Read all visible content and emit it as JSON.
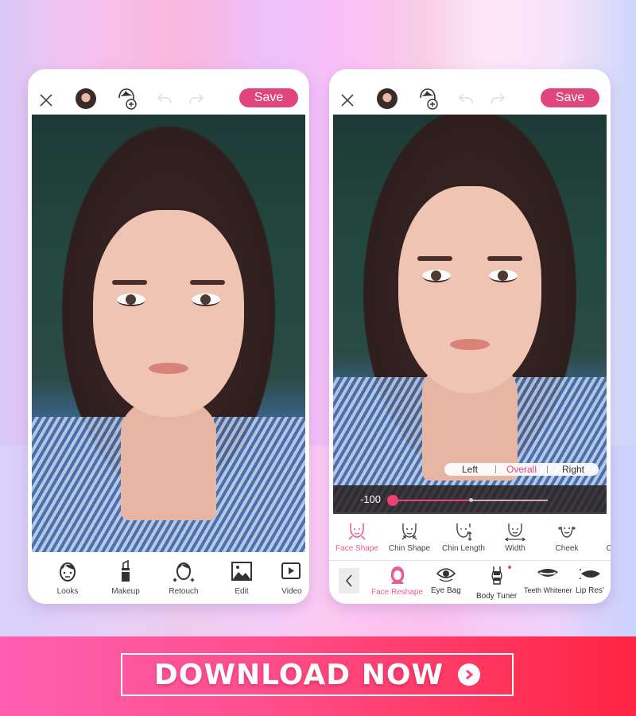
{
  "left_phone": {
    "topbar": {
      "close_icon": "close-icon",
      "avatar_icon": "face-avatar",
      "add_face_icon": "add-face-icon",
      "undo_icon": "undo-icon",
      "redo_icon": "redo-icon",
      "save_label": "Save"
    },
    "toolbar": [
      {
        "label": "Looks",
        "icon": "looks-face-icon"
      },
      {
        "label": "Makeup",
        "icon": "lipstick-icon"
      },
      {
        "label": "Retouch",
        "icon": "retouch-face-icon"
      },
      {
        "label": "Edit",
        "icon": "image-icon"
      },
      {
        "label": "Video",
        "icon": "video-icon"
      }
    ]
  },
  "right_phone": {
    "topbar": {
      "close_icon": "close-icon",
      "avatar_icon": "face-avatar",
      "add_face_icon": "add-face-icon",
      "undo_icon": "undo-icon",
      "redo_icon": "redo-icon",
      "save_label": "Save"
    },
    "segment": {
      "options": [
        "Left",
        "Overall",
        "Right"
      ],
      "selected": "Overall"
    },
    "slider": {
      "value_label": "-100",
      "min": -100,
      "max": 100,
      "value": -100
    },
    "subtools": [
      {
        "label": "Face Shape",
        "active": true
      },
      {
        "label": "Chin Shape",
        "active": false
      },
      {
        "label": "Chin Length",
        "active": false
      },
      {
        "label": "Width",
        "active": false
      },
      {
        "label": "Cheek",
        "active": false
      },
      {
        "label": "Ch",
        "active": false
      }
    ],
    "maintools": [
      {
        "label": "Face Reshape",
        "active": true
      },
      {
        "label": "Eye Bag",
        "active": false
      },
      {
        "label": "Body Tuner",
        "active": false,
        "new_dot": true
      },
      {
        "label": "Teeth Whitener",
        "active": false
      },
      {
        "label": "Lip Res'",
        "active": false
      }
    ]
  },
  "banner": {
    "cta_label": "DOWNLOAD NOW",
    "colors": {
      "start": "#ff5fb2",
      "end": "#ff2342"
    }
  },
  "accent_color": "#e0457b"
}
